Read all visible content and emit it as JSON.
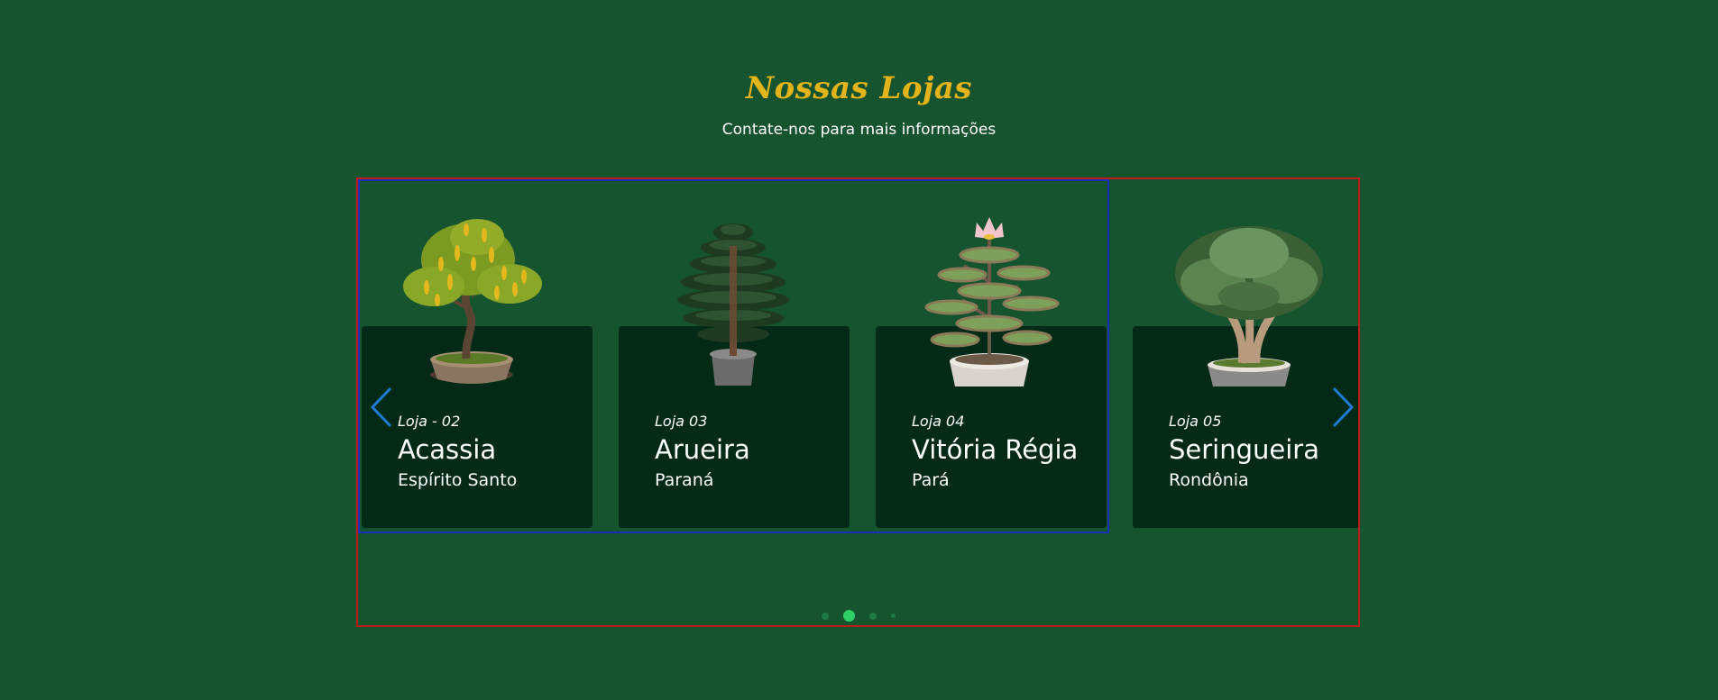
{
  "section": {
    "title": "Nossas Lojas",
    "subtitle": "Contate-nos para mais informações"
  },
  "stores": [
    {
      "label": "Loja - 02",
      "name": "Acassia",
      "state": "Espírito Santo",
      "plant": "acacia-bonsai-icon"
    },
    {
      "label": "Loja 03",
      "name": "Arueira",
      "state": "Paraná",
      "plant": "araucaria-bonsai-icon"
    },
    {
      "label": "Loja 04",
      "name": "Vitória Régia",
      "state": "Pará",
      "plant": "water-lily-tower-icon"
    },
    {
      "label": "Loja 05",
      "name": "Seringueira",
      "state": "Rondônia",
      "plant": "rubber-tree-bonsai-icon"
    }
  ],
  "carousel": {
    "prev_icon": "chevron-left-icon",
    "next_icon": "chevron-right-icon",
    "pages": 4,
    "active_page": 2
  },
  "colors": {
    "background": "#16532f",
    "card": "#032a16",
    "title": "#e2b41a",
    "arrow": "#1f7bd8",
    "dot_active": "#2fd068"
  }
}
